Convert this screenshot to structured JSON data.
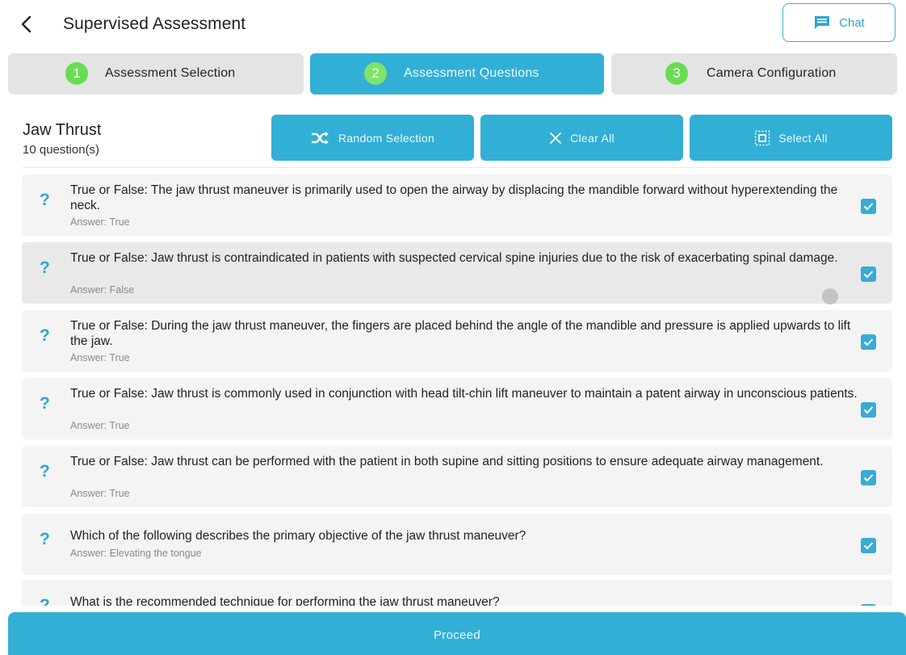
{
  "header": {
    "title": "Supervised Assessment",
    "chat_label": "Chat"
  },
  "steps": [
    {
      "number": "1",
      "label": "Assessment Selection",
      "active": false
    },
    {
      "number": "2",
      "label": "Assessment Questions",
      "active": true
    },
    {
      "number": "3",
      "label": "Camera Configuration",
      "active": false
    }
  ],
  "section": {
    "title": "Jaw Thrust",
    "count": "10 question(s)",
    "random_label": "Random Selection",
    "clear_label": "Clear All",
    "select_label": "Select All"
  },
  "questions": [
    {
      "mark": "?",
      "text": "True or False: The jaw thrust maneuver is primarily used to open the airway by displacing the mandible forward without hyperextending the neck.",
      "answer": "Answer: True",
      "checked": true
    },
    {
      "mark": "?",
      "text": "True or False: Jaw thrust is contraindicated in patients with suspected cervical spine injuries due to the risk of exacerbating spinal damage.",
      "answer": "Answer: False",
      "checked": true
    },
    {
      "mark": "?",
      "text": "True or False: During the jaw thrust maneuver, the fingers are placed behind the angle of the mandible and pressure is applied upwards to lift the jaw.",
      "answer": "Answer: True",
      "checked": true
    },
    {
      "mark": "?",
      "text": "True or False: Jaw thrust is commonly used in conjunction with head tilt-chin lift maneuver to maintain a patent airway in unconscious patients.",
      "answer": "Answer: True",
      "checked": true
    },
    {
      "mark": "?",
      "text": "True or False: Jaw thrust can be performed with the patient in both supine and sitting positions to ensure adequate airway management.",
      "answer": "Answer: True",
      "checked": true
    },
    {
      "mark": "?",
      "text": "Which of the following describes the primary objective of the jaw thrust maneuver?",
      "answer": "Answer: Elevating the tongue",
      "checked": true
    },
    {
      "mark": "?",
      "text": "What is the recommended technique for performing the jaw thrust maneuver?",
      "answer": "",
      "checked": true
    }
  ],
  "footer": {
    "proceed_label": "Proceed"
  },
  "colors": {
    "accent": "#32afd6",
    "step_number": "#68dc52",
    "inactive_step": "#e4e4e4",
    "card": "#f4f4f4"
  }
}
